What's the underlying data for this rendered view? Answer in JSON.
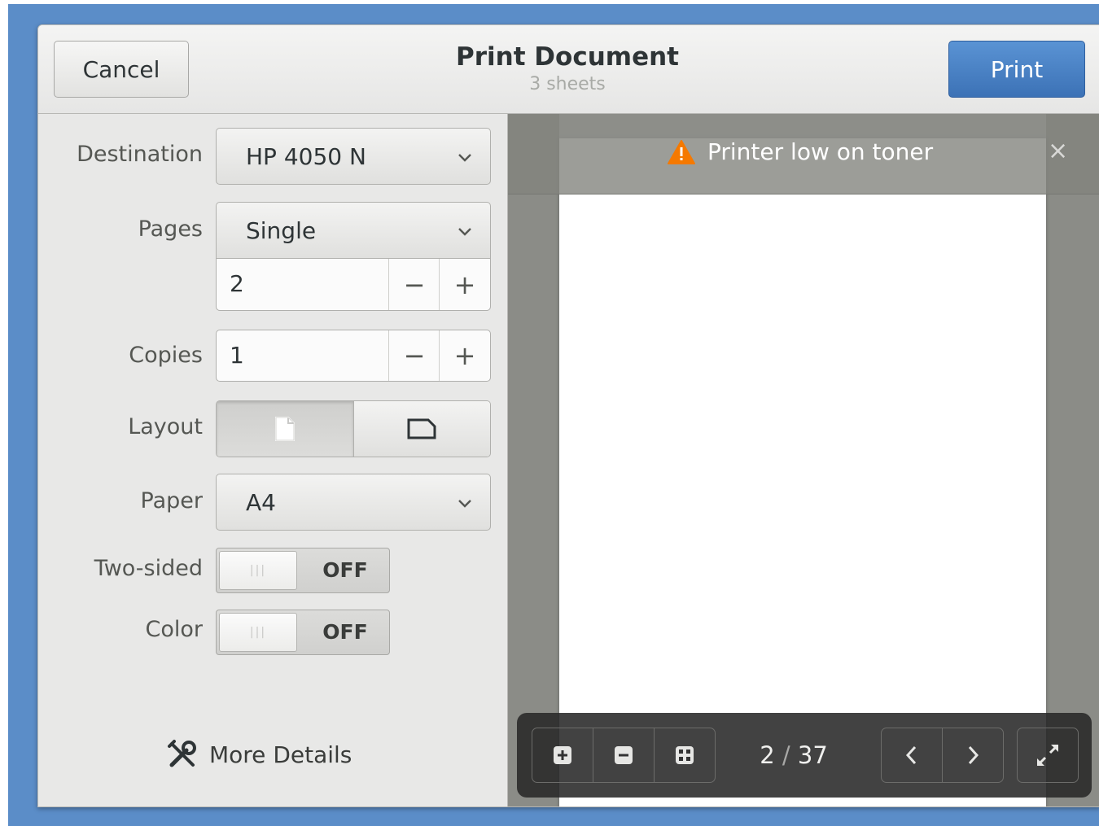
{
  "header": {
    "cancel_label": "Cancel",
    "title": "Print Document",
    "subtitle": "3 sheets",
    "print_label": "Print"
  },
  "settings": {
    "destination": {
      "label": "Destination",
      "value": "HP 4050 N"
    },
    "pages": {
      "label": "Pages",
      "value": "Single",
      "page_number": "2"
    },
    "copies": {
      "label": "Copies",
      "value": "1"
    },
    "layout": {
      "label": "Layout",
      "options": [
        "portrait-icon",
        "landscape-icon"
      ],
      "selected": "portrait"
    },
    "paper": {
      "label": "Paper",
      "value": "A4"
    },
    "two_sided": {
      "label": "Two-sided",
      "state": "OFF"
    },
    "color": {
      "label": "Color",
      "state": "OFF"
    },
    "more_details": "More Details",
    "spin_minus": "−",
    "spin_plus": "+"
  },
  "preview": {
    "notice": "Printer low on toner",
    "notice_close": "×",
    "current_page": "2",
    "total_pages": "37",
    "page_separator": "/"
  },
  "colors": {
    "accent": "#3c72b6",
    "warning": "#f57900",
    "desktop": "#5b8dc8"
  }
}
